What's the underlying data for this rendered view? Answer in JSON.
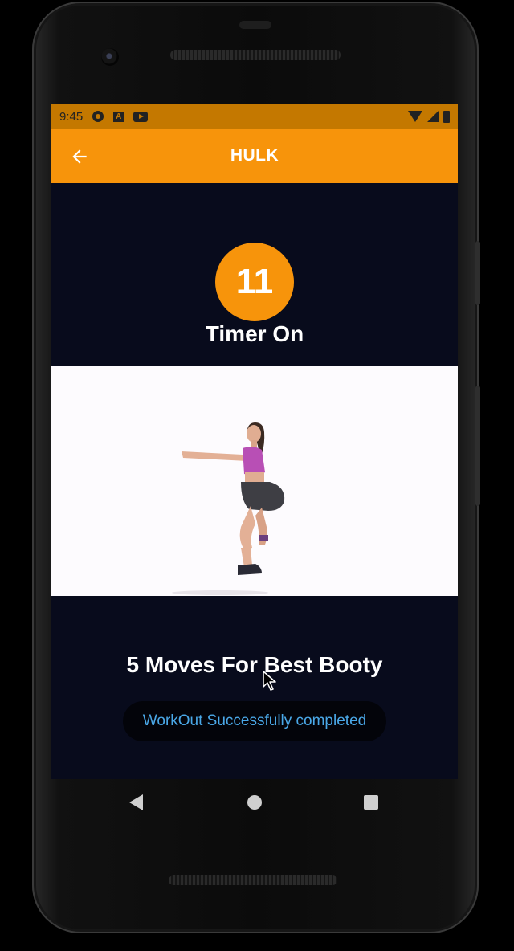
{
  "status_bar": {
    "time": "9:45"
  },
  "app_bar": {
    "title": "HULK",
    "back_icon": "arrow-left-icon"
  },
  "timer": {
    "count": "11",
    "label": "Timer On"
  },
  "exercise": {
    "title": "5 Moves For Best Booty",
    "image": "woman-squat-exercise"
  },
  "completion": {
    "message": "WorkOut Successfully completed"
  },
  "navigation": {
    "back_icon": "triangle-back-icon",
    "home_icon": "circle-home-icon",
    "recents_icon": "square-recents-icon"
  },
  "colors": {
    "accent": "#f7940b",
    "status_bar": "#c47800",
    "background": "#080b1c",
    "link_text": "#4aa8e8"
  }
}
